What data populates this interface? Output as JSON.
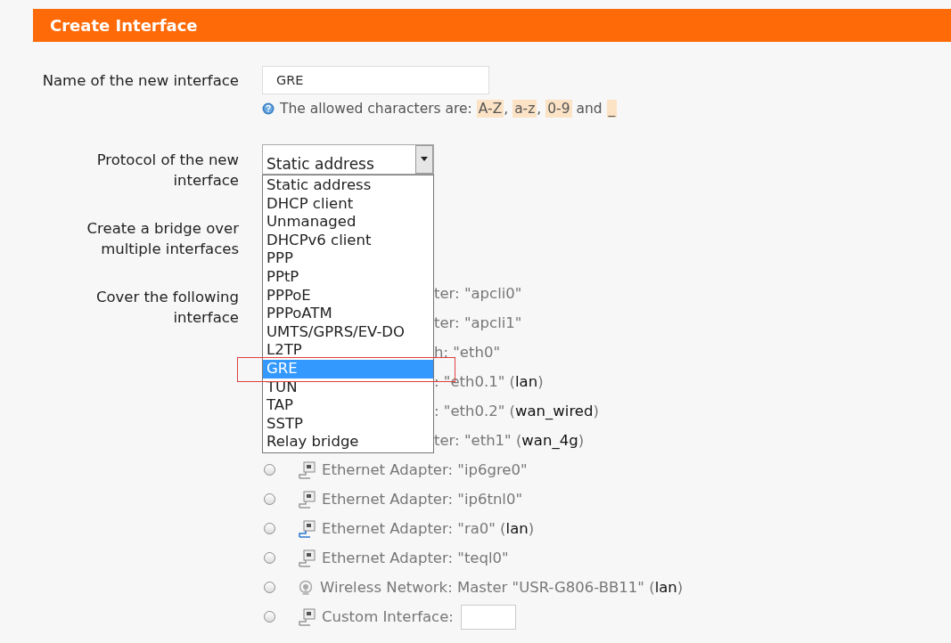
{
  "header": {
    "title": "Create Interface"
  },
  "name_field": {
    "label": "Name of the new interface",
    "value": "GRE",
    "hint": [
      {
        "kind": "plain",
        "text": "The allowed characters are: "
      },
      {
        "kind": "code",
        "text": "A-Z"
      },
      {
        "kind": "plain",
        "text": ", "
      },
      {
        "kind": "code",
        "text": "a-z"
      },
      {
        "kind": "plain",
        "text": ", "
      },
      {
        "kind": "code",
        "text": "0-9"
      },
      {
        "kind": "plain",
        "text": " and "
      },
      {
        "kind": "code",
        "text": "_"
      }
    ]
  },
  "protocol": {
    "label": "Protocol of the new interface",
    "value": "Static address",
    "expanded": true,
    "options": [
      {
        "label": "Static address",
        "highlighted": false
      },
      {
        "label": "DHCP client",
        "highlighted": false
      },
      {
        "label": "Unmanaged",
        "highlighted": false
      },
      {
        "label": "DHCPv6 client",
        "highlighted": false
      },
      {
        "label": "PPP",
        "highlighted": false
      },
      {
        "label": "PPtP",
        "highlighted": false
      },
      {
        "label": "PPPoE",
        "highlighted": false
      },
      {
        "label": "PPPoATM",
        "highlighted": false
      },
      {
        "label": "UMTS/GPRS/EV-DO",
        "highlighted": false
      },
      {
        "label": "L2TP",
        "highlighted": false
      },
      {
        "label": "GRE",
        "highlighted": true
      },
      {
        "label": "TUN",
        "highlighted": false
      },
      {
        "label": "TAP",
        "highlighted": false
      },
      {
        "label": "SSTP",
        "highlighted": false
      },
      {
        "label": "Relay bridge",
        "highlighted": false
      }
    ]
  },
  "bridge": {
    "label": "Create a bridge over multiple interfaces"
  },
  "cover": {
    "label": "Cover the following interface",
    "rows": [
      {
        "kind": "partial",
        "text": "ter: \"apcli0\""
      },
      {
        "kind": "partial",
        "text": "ter: \"apcli1\""
      },
      {
        "kind": "partial",
        "text": "h: \"eth0\""
      },
      {
        "kind": "partial",
        "text": ": \"eth0.1\" (**lan**)"
      },
      {
        "kind": "partial",
        "text": ": \"eth0.2\" (**wan_wired**)"
      },
      {
        "kind": "partial",
        "text": "ter: \"eth1\" (**wan_4g**)"
      },
      {
        "kind": "ethernet",
        "text": "Ethernet Adapter: \"ip6gre0\"",
        "selected": false,
        "active": false
      },
      {
        "kind": "ethernet",
        "text": "Ethernet Adapter: \"ip6tnl0\"",
        "selected": false,
        "active": false
      },
      {
        "kind": "ethernet",
        "text": "Ethernet Adapter: \"ra0\" (**lan**)",
        "selected": false,
        "active": true
      },
      {
        "kind": "ethernet",
        "text": "Ethernet Adapter: \"teql0\"",
        "selected": false,
        "active": false
      },
      {
        "kind": "wireless",
        "text": "Wireless Network: Master \"USR-G806-BB11\" (**lan**)",
        "selected": false,
        "active": false
      },
      {
        "kind": "custom",
        "text": "Custom Interface:",
        "selected": false,
        "active": false
      }
    ]
  }
}
